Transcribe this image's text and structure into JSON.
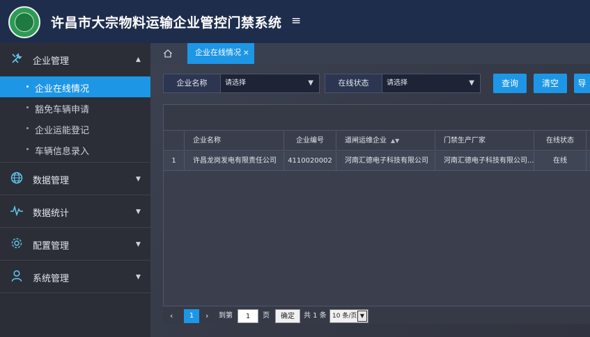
{
  "header": {
    "title": "许昌市大宗物料运输企业管控门禁系统",
    "menu_icon": "≡"
  },
  "sidebar": {
    "sections": [
      {
        "label": "企业管理",
        "icon": "tools-icon",
        "expanded": true,
        "items": [
          {
            "label": "企业在线情况",
            "active": true
          },
          {
            "label": "豁免车辆申请"
          },
          {
            "label": "企业运能登记"
          },
          {
            "label": "车辆信息录入"
          }
        ]
      },
      {
        "label": "数据管理",
        "icon": "globe-icon"
      },
      {
        "label": "数据统计",
        "icon": "pulse-icon"
      },
      {
        "label": "配置管理",
        "icon": "gear-icon"
      },
      {
        "label": "系统管理",
        "icon": "user-icon"
      }
    ]
  },
  "tabs": {
    "active_label": "企业在线情况",
    "close": "×"
  },
  "filters": {
    "company_label": "企业名称",
    "company_value": "请选择",
    "online_label": "在线状态",
    "online_value": "请选择"
  },
  "buttons": {
    "query": "查询",
    "clear": "清空",
    "export": "导"
  },
  "table": {
    "columns": [
      "企业名称",
      "企业编号",
      "道闸运维企业",
      "门禁生产厂家",
      "在线状态"
    ],
    "rows": [
      {
        "index": "1",
        "name": "许昌龙岗发电有限责任公司",
        "code": "4110020002",
        "maint": "河南汇德电子科技有限公司",
        "maker": "河南汇德电子科技有限公司...",
        "status": "在线"
      }
    ]
  },
  "pager": {
    "current": "1",
    "goto_label": "到第",
    "goto_value": "1",
    "page_unit": "页",
    "confirm": "确定",
    "total": "共 1 条",
    "page_size": "10 条/页"
  },
  "colors": {
    "accent": "#1e96e6",
    "header": "#1f2d4d",
    "sidebar": "#2b2e37",
    "icon": "#66c8f2"
  }
}
